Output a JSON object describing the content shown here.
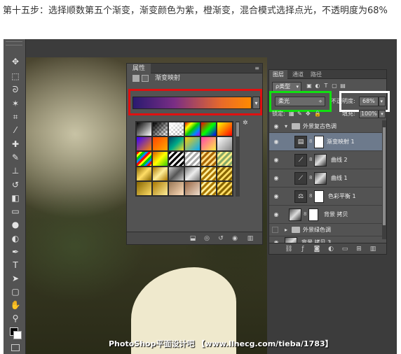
{
  "caption": "第十五步：选择顺数第五个渐变，渐变颜色为紫，橙渐变，混合模式选择点光，不透明度为68%",
  "watermark": "PhotoShop平面设计吧 【www.llnecg.com/tieba/1783】",
  "properties_panel": {
    "tab_label": "属性",
    "adjustment_name": "渐变映射",
    "gradient_colors": [
      "#2a1a70",
      "#7a2e85",
      "#e86a2a",
      "#ff8a00"
    ],
    "dropdown_arrow": "▾"
  },
  "layers_panel": {
    "tabs": [
      "图层",
      "通道",
      "路径"
    ],
    "filter_label": "ρ类型",
    "blend_mode": "柔光",
    "opacity_label": "不透明度:",
    "opacity_value": "68%",
    "lock_label": "锁定:",
    "fill_label": "填充:",
    "fill_value": "100%",
    "layers": [
      {
        "name": "外景复古色调",
        "kind": "group"
      },
      {
        "name": "渐变映射 1",
        "kind": "adjustment",
        "selected": true
      },
      {
        "name": "曲线 2",
        "kind": "adjustment"
      },
      {
        "name": "曲线 1",
        "kind": "adjustment"
      },
      {
        "name": "色彩平衡 1",
        "kind": "adjustment"
      },
      {
        "name": "背景 拷贝",
        "kind": "pixel"
      },
      {
        "name": "外景绿色调",
        "kind": "group"
      },
      {
        "name": "背景 拷贝 3",
        "kind": "pixel"
      }
    ]
  },
  "accent_colors": {
    "red": "#e01010",
    "green": "#10e010",
    "white": "#ffffff"
  }
}
